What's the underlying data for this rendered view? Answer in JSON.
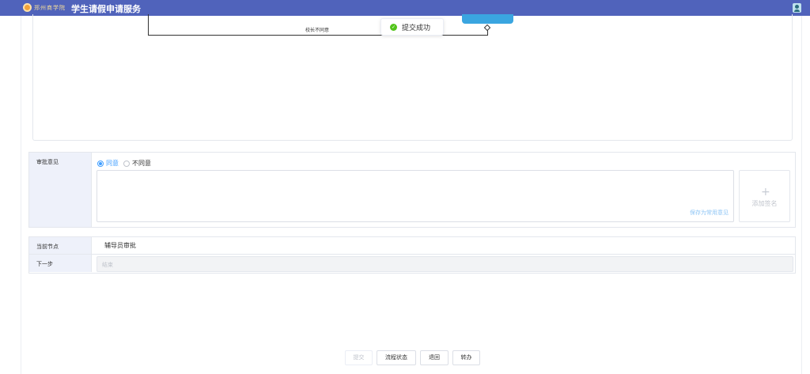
{
  "header": {
    "school_name": "郑州商学院",
    "app_title": "学生请假申请服务"
  },
  "flow": {
    "edge_label": "校长不同意"
  },
  "toast": {
    "message": "提交成功"
  },
  "opinion": {
    "label": "审批意见",
    "options": [
      "同意",
      "不同意"
    ],
    "selected": "同意",
    "save_common_label": "保存为常用意见",
    "add_signature_label": "添加签名"
  },
  "node_info": {
    "current_node_label": "当前节点",
    "current_node_value": "辅导员审批",
    "next_step_label": "下一步",
    "next_step_value": "结束"
  },
  "actions": {
    "submit": "提交",
    "flow_status": "流程状态",
    "return": "退回",
    "transfer": "转办"
  },
  "colors": {
    "header_bg": "#5063bb",
    "accent": "#409eff",
    "success": "#52c41a",
    "label_cell_bg": "#eef1fa"
  }
}
